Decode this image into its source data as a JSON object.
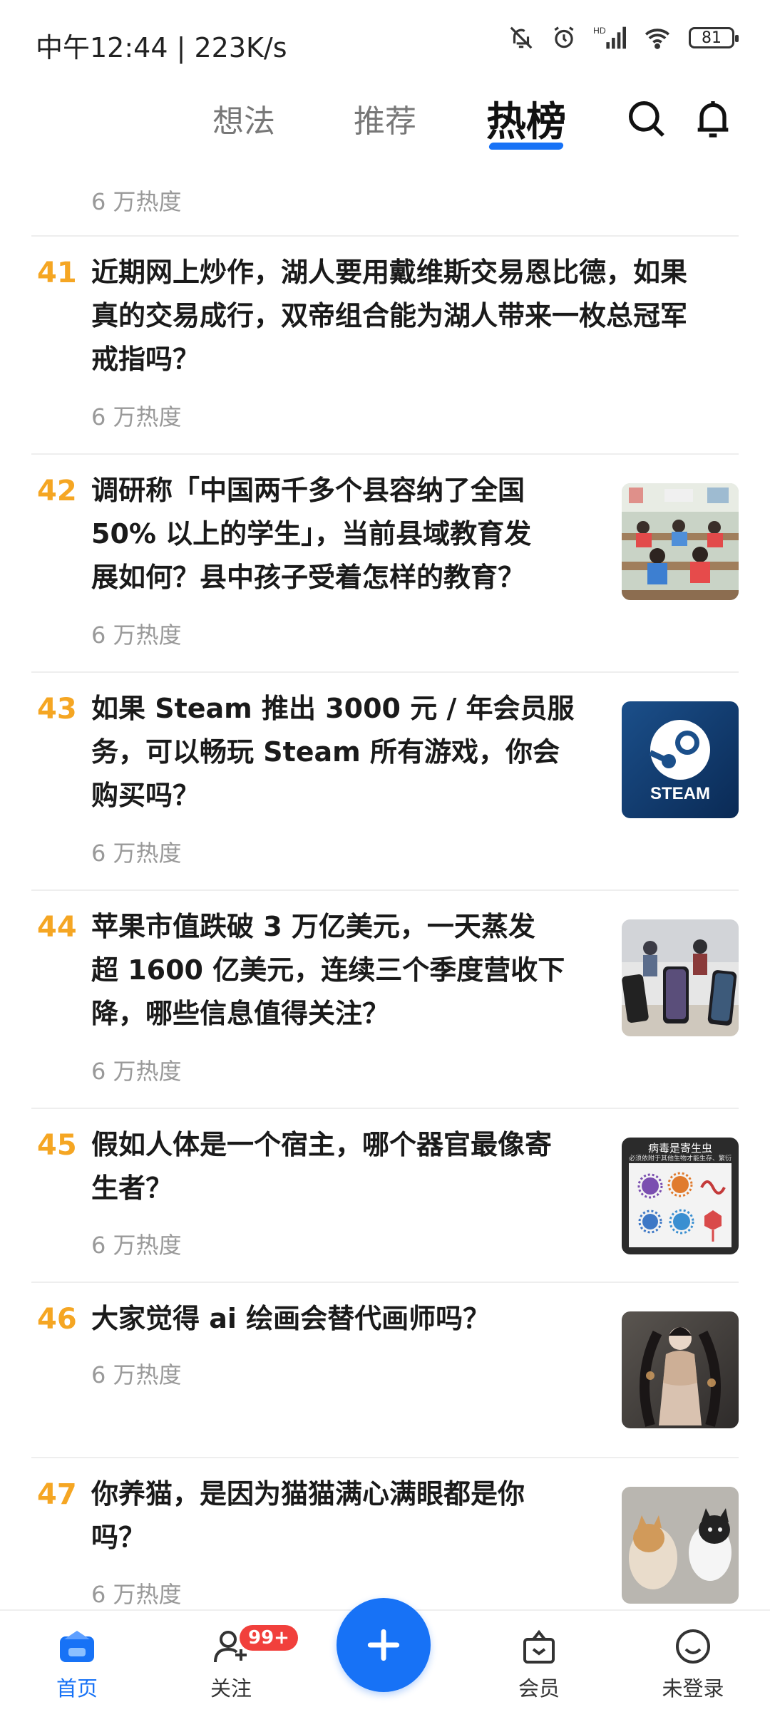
{
  "status": {
    "time": "中午12:44 | 223K/s",
    "battery": "81"
  },
  "topnav": {
    "tabs": [
      "想法",
      "推荐",
      "热榜"
    ],
    "active_tab": "热榜"
  },
  "feed": {
    "partial_heat": "6 万热度",
    "items": [
      {
        "rank": "41",
        "title_lines": [
          "近期网上炒作，湖人要用戴维斯交易恩比德，如果",
          "真的交易成行，双帝组合能为湖人带来一枚总冠军",
          "戒指吗？"
        ],
        "heat": "6 万热度",
        "thumb": ""
      },
      {
        "rank": "42",
        "title_lines": [
          "调研称「中国两千多个县容纳了全国",
          "50% 以上的学生」，当前县域教育发",
          "展如何？县中孩子受着怎样的教育？"
        ],
        "heat": "6 万热度",
        "thumb": "classroom"
      },
      {
        "rank": "43",
        "title_lines": [
          "如果 Steam 推出 3000 元 / 年会员服",
          "务，可以畅玩 Steam 所有游戏，你会",
          "购买吗？"
        ],
        "heat": "6 万热度",
        "thumb": "steam"
      },
      {
        "rank": "44",
        "title_lines": [
          "苹果市值跌破 3 万亿美元，一天蒸发",
          "超 1600 亿美元，连续三个季度营收下",
          "降，哪些信息值得关注？"
        ],
        "heat": "6 万热度",
        "thumb": "iphones"
      },
      {
        "rank": "45",
        "title_lines": [
          "假如人体是一个宿主，哪个器官最像寄",
          "生者？"
        ],
        "heat": "6 万热度",
        "thumb": "virus"
      },
      {
        "rank": "46",
        "title_lines": [
          "大家觉得 ai 绘画会替代画师吗？"
        ],
        "heat": "6 万热度",
        "thumb": "ai-art"
      },
      {
        "rank": "47",
        "title_lines": [
          "你养猫，是因为猫猫满心满眼都是你",
          "吗？"
        ],
        "heat": "6 万热度",
        "thumb": "cats"
      }
    ],
    "steam_text": "STEAM",
    "virus_caption_1": "病毒是寄生虫",
    "virus_caption_2": "必须依附于其他生物才能生存、繁衍"
  },
  "bottomnav": {
    "items": [
      "首页",
      "关注",
      "会员",
      "未登录"
    ],
    "badge": "99+"
  },
  "colors": {
    "accent": "#1772F6",
    "rank": "#F5A623",
    "badge": "#F1403C"
  }
}
